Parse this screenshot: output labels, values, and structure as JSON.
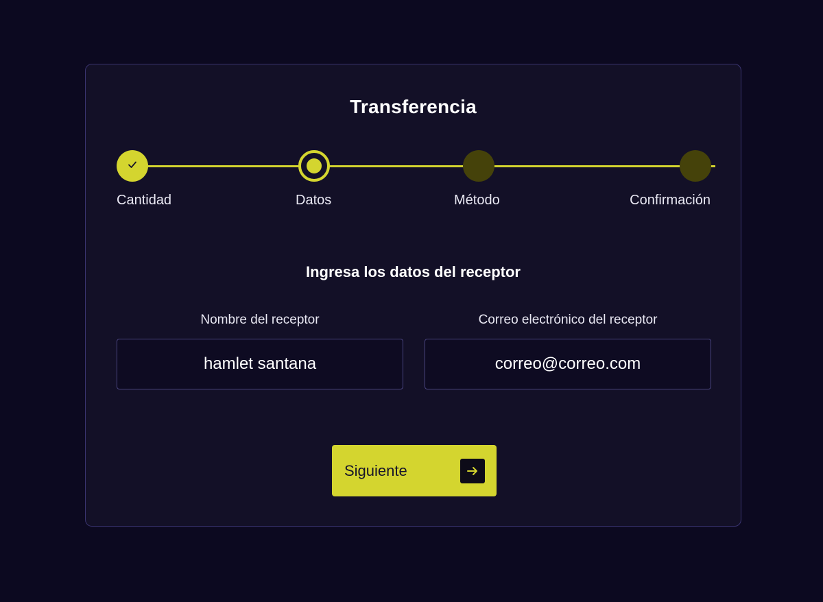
{
  "header": {
    "title": "Transferencia"
  },
  "stepper": {
    "steps": [
      {
        "label": "Cantidad",
        "state": "done"
      },
      {
        "label": "Datos",
        "state": "current"
      },
      {
        "label": "Método",
        "state": "pending"
      },
      {
        "label": "Confirmación",
        "state": "pending"
      }
    ]
  },
  "form": {
    "subtitle": "Ingresa los datos del receptor",
    "name_field": {
      "label": "Nombre del receptor",
      "value": "hamlet santana"
    },
    "email_field": {
      "label": "Correo electrónico del receptor",
      "value": "correo@correo.com"
    }
  },
  "actions": {
    "next_label": "Siguiente",
    "next_icon": "arrow-right-icon"
  },
  "colors": {
    "background": "#0c0920",
    "card": "#131027",
    "accent": "#d4d52f",
    "pending_step": "#45420a"
  }
}
